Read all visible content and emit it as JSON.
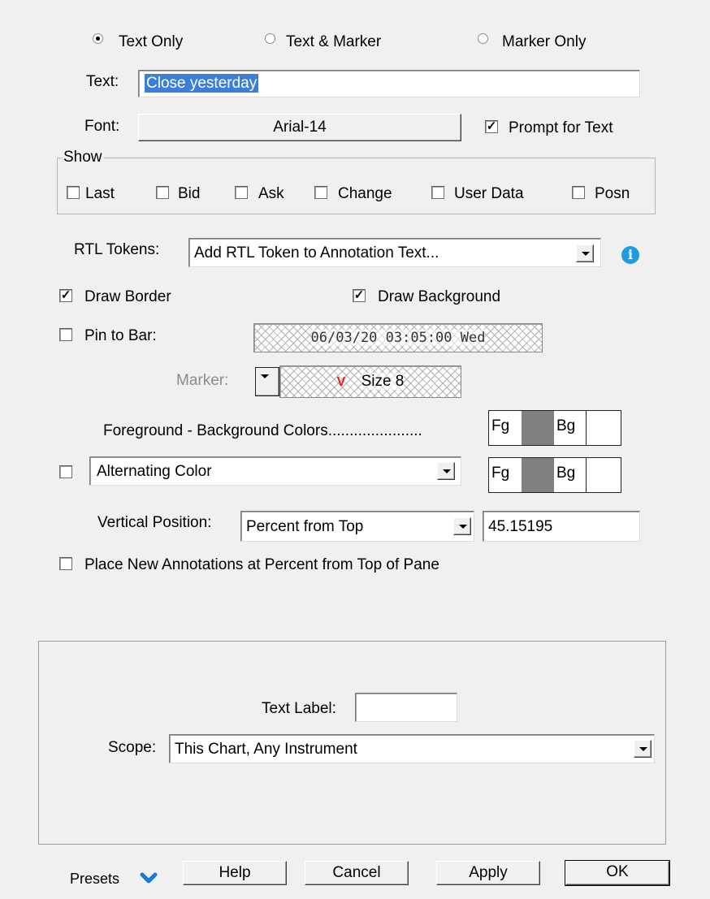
{
  "text_mode": {
    "options": [
      "Text Only",
      "Text & Marker",
      "Marker Only"
    ],
    "selected": "Text Only"
  },
  "text": {
    "label": "Text:",
    "value": "Close yesterday"
  },
  "font": {
    "label": "Font:",
    "value": "Arial-14"
  },
  "prompt_for_text": {
    "label": "Prompt for Text",
    "checked": true
  },
  "show": {
    "title": "Show",
    "items": [
      {
        "label": "Last",
        "checked": false
      },
      {
        "label": "Bid",
        "checked": false
      },
      {
        "label": "Ask",
        "checked": false
      },
      {
        "label": "Change",
        "checked": false
      },
      {
        "label": "User Data",
        "checked": false
      },
      {
        "label": "Posn",
        "checked": false
      }
    ]
  },
  "rtl_tokens": {
    "label": "RTL Tokens:",
    "value": "Add RTL Token to Annotation Text...",
    "info_icon": "info-icon"
  },
  "draw_border": {
    "label": "Draw Border",
    "checked": true
  },
  "draw_background": {
    "label": "Draw Background",
    "checked": true
  },
  "pin_to_bar": {
    "label": "Pin to Bar:",
    "checked": false,
    "datetime": "06/03/20 03:05:00 Wed"
  },
  "marker": {
    "label": "Marker:",
    "size_text": "Size 8",
    "glyph": "V",
    "glyph_color": "#e02020"
  },
  "colors": {
    "label": "Foreground - Background Colors......................",
    "fg": "Fg",
    "bg": "Bg",
    "fg_color": "#808080",
    "bg_color": "#ffffff"
  },
  "alternating": {
    "checked": false,
    "value": "Alternating Color",
    "fg": "Fg",
    "bg": "Bg",
    "fg_color": "#808080",
    "bg_color": "#ffffff"
  },
  "vertical_position": {
    "label": "Vertical Position:",
    "value": "Percent from Top",
    "number": "45.15195"
  },
  "place_new": {
    "label": "Place New Annotations at Percent from Top of Pane",
    "checked": false
  },
  "text_label": {
    "label": "Text Label:",
    "value": ""
  },
  "scope": {
    "label": "Scope:",
    "value": "This Chart, Any Instrument"
  },
  "footer": {
    "presets": "Presets",
    "help": "Help",
    "cancel": "Cancel",
    "apply": "Apply",
    "ok": "OK"
  }
}
